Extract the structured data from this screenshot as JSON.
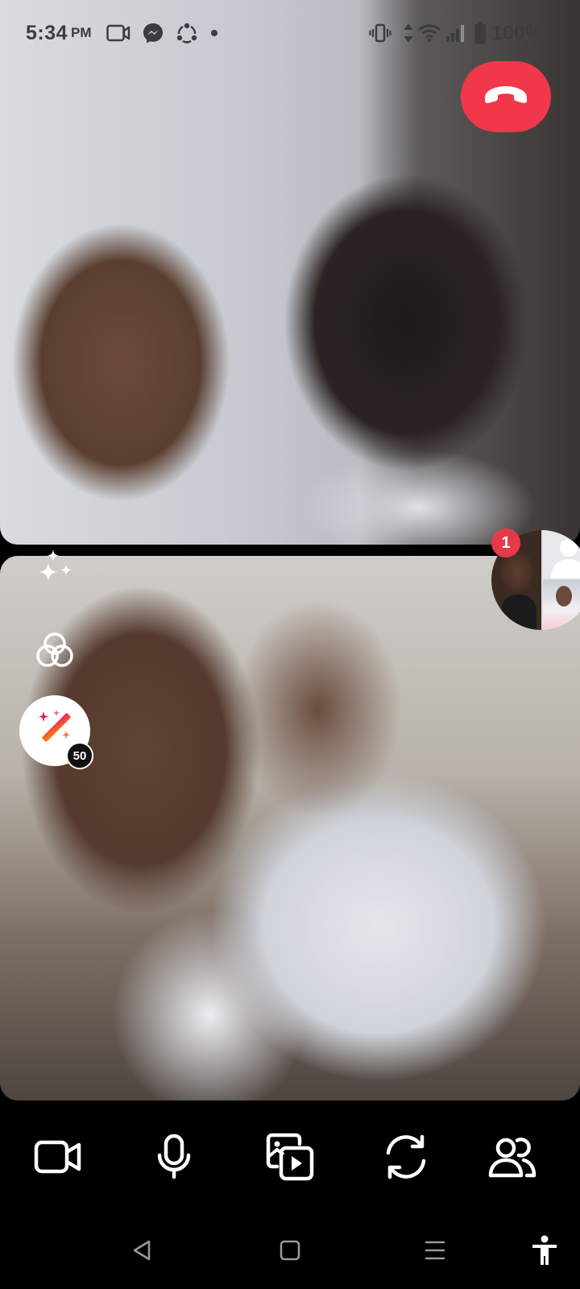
{
  "status_bar": {
    "time": "5:34",
    "ampm": "PM",
    "battery": "100%",
    "icons": [
      "video-call-icon",
      "messenger-icon",
      "sync-icon",
      "dot-icon",
      "vibrate-icon",
      "data-arrows-icon",
      "wifi-icon",
      "signal-icon",
      "battery-icon"
    ]
  },
  "call": {
    "end_call_icon": "phone-hangup-icon",
    "end_call_color": "#f0384a"
  },
  "side_tools": {
    "effects_icon": "sparkles-icon",
    "filters_icon": "filter-circles-icon",
    "magic_icon": "magic-wand-icon",
    "magic_count": "50"
  },
  "participants": {
    "badge_count": "1"
  },
  "controls": [
    {
      "name": "camera-toggle",
      "icon": "video-camera-icon"
    },
    {
      "name": "mic-toggle",
      "icon": "microphone-icon"
    },
    {
      "name": "share-media",
      "icon": "media-share-icon"
    },
    {
      "name": "flip-camera",
      "icon": "flip-camera-icon"
    },
    {
      "name": "people",
      "icon": "people-icon"
    }
  ],
  "nav": [
    "back-icon",
    "home-icon",
    "recents-icon",
    "accessibility-icon"
  ]
}
